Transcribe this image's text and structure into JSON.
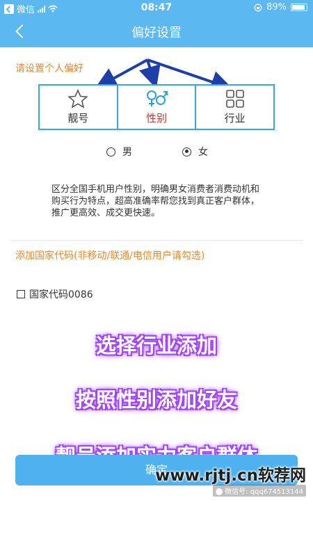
{
  "status_bar": {
    "carrier": "微信",
    "time": "08:47",
    "battery": "89%",
    "battery_level": 0.89
  },
  "nav": {
    "title": "偏好设置"
  },
  "preferences": {
    "section_label": "请设置个人偏好",
    "tabs": [
      {
        "label": "靓号",
        "icon": "star-icon",
        "active": false
      },
      {
        "label": "性别",
        "icon": "gender-icon",
        "active": true
      },
      {
        "label": "行业",
        "icon": "grid-icon",
        "active": false
      }
    ]
  },
  "gender": {
    "options": [
      "男",
      "女"
    ],
    "selected": "女"
  },
  "description": "区分全国手机用户性别，明确男女消费者消费动机和购买行为特点，超高准确率帮您找到真正客户群体，推广更高效、成交更快速。",
  "country_code": {
    "label": "添加国家代码(非移动/联通/电信用户请勾选)",
    "checkbox_label": "国家代码0086",
    "checked": false
  },
  "promo_lines": [
    "选择行业添加",
    "按照性别添加好友",
    "靓号添加实力客户群体"
  ],
  "confirm_label": "确定",
  "watermark": {
    "main": "www.rjtj.cn软荐网",
    "sub": "微信号: qqq674513144"
  },
  "colors": {
    "primary": "#5bb8f0",
    "accent_orange": "#e88a2c",
    "active_red": "#c8352e",
    "promo_glow": "#a040ff",
    "arrow": "#1e3fa8"
  }
}
